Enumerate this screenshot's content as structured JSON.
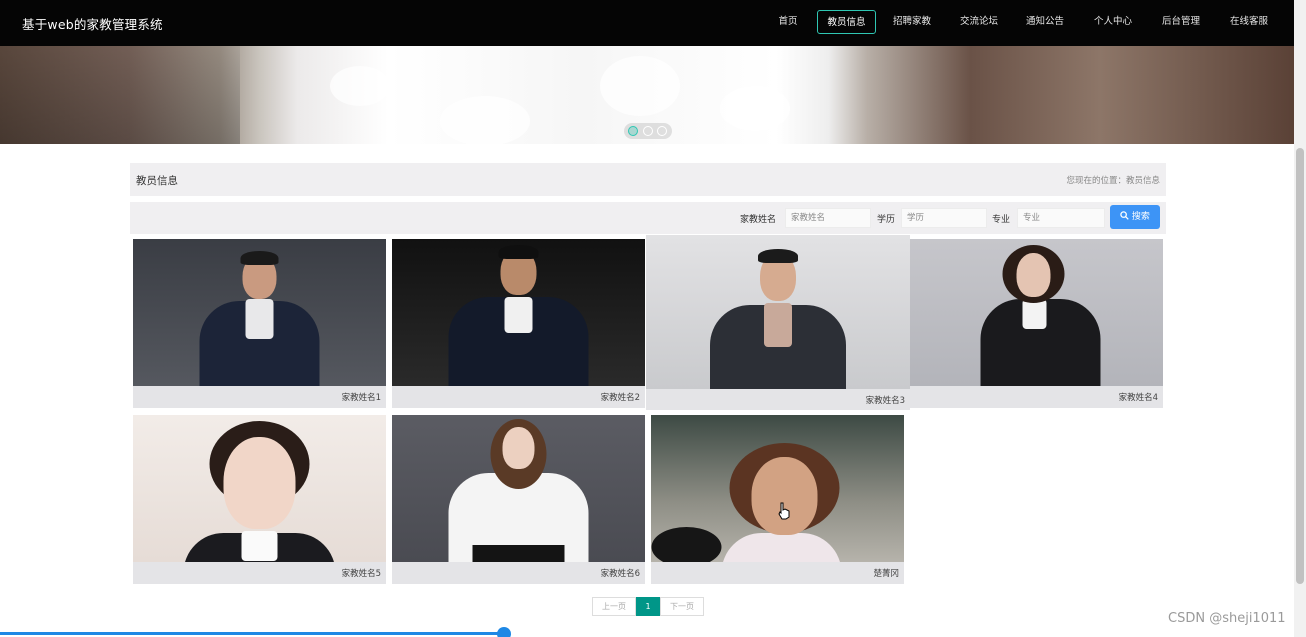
{
  "header": {
    "site_title": "基于web的家教管理系统",
    "nav": [
      {
        "label": "首页",
        "active": false
      },
      {
        "label": "教员信息",
        "active": true
      },
      {
        "label": "招聘家教",
        "active": false
      },
      {
        "label": "交流论坛",
        "active": false
      },
      {
        "label": "通知公告",
        "active": false
      },
      {
        "label": "个人中心",
        "active": false
      },
      {
        "label": "后台管理",
        "active": false
      },
      {
        "label": "在线客服",
        "active": false
      }
    ]
  },
  "carousel": {
    "slide_count": 3,
    "active_index": 0
  },
  "section": {
    "title": "教员信息",
    "breadcrumb": "您现在的位置：教员信息"
  },
  "search": {
    "name_label": "家教姓名",
    "name_placeholder": "家教姓名",
    "edu_label": "学历",
    "edu_placeholder": "学历",
    "major_label": "专业",
    "major_placeholder": "专业",
    "button_label": "搜索",
    "button_icon": "search-icon"
  },
  "tutors": [
    {
      "name": "家教姓名1"
    },
    {
      "name": "家教姓名2"
    },
    {
      "name": "家教姓名3"
    },
    {
      "name": "家教姓名4"
    },
    {
      "name": "家教姓名5"
    },
    {
      "name": "家教姓名6"
    },
    {
      "name": "楚菁冈"
    }
  ],
  "pagination": {
    "prev_label": "上一页",
    "current_page": "1",
    "next_label": "下一页"
  },
  "watermark": "CSDN @sheji1011",
  "colors": {
    "nav_bg": "#050505",
    "accent": "#2fc7b3",
    "search_button": "#3d94f6",
    "pager_active": "#009688"
  }
}
